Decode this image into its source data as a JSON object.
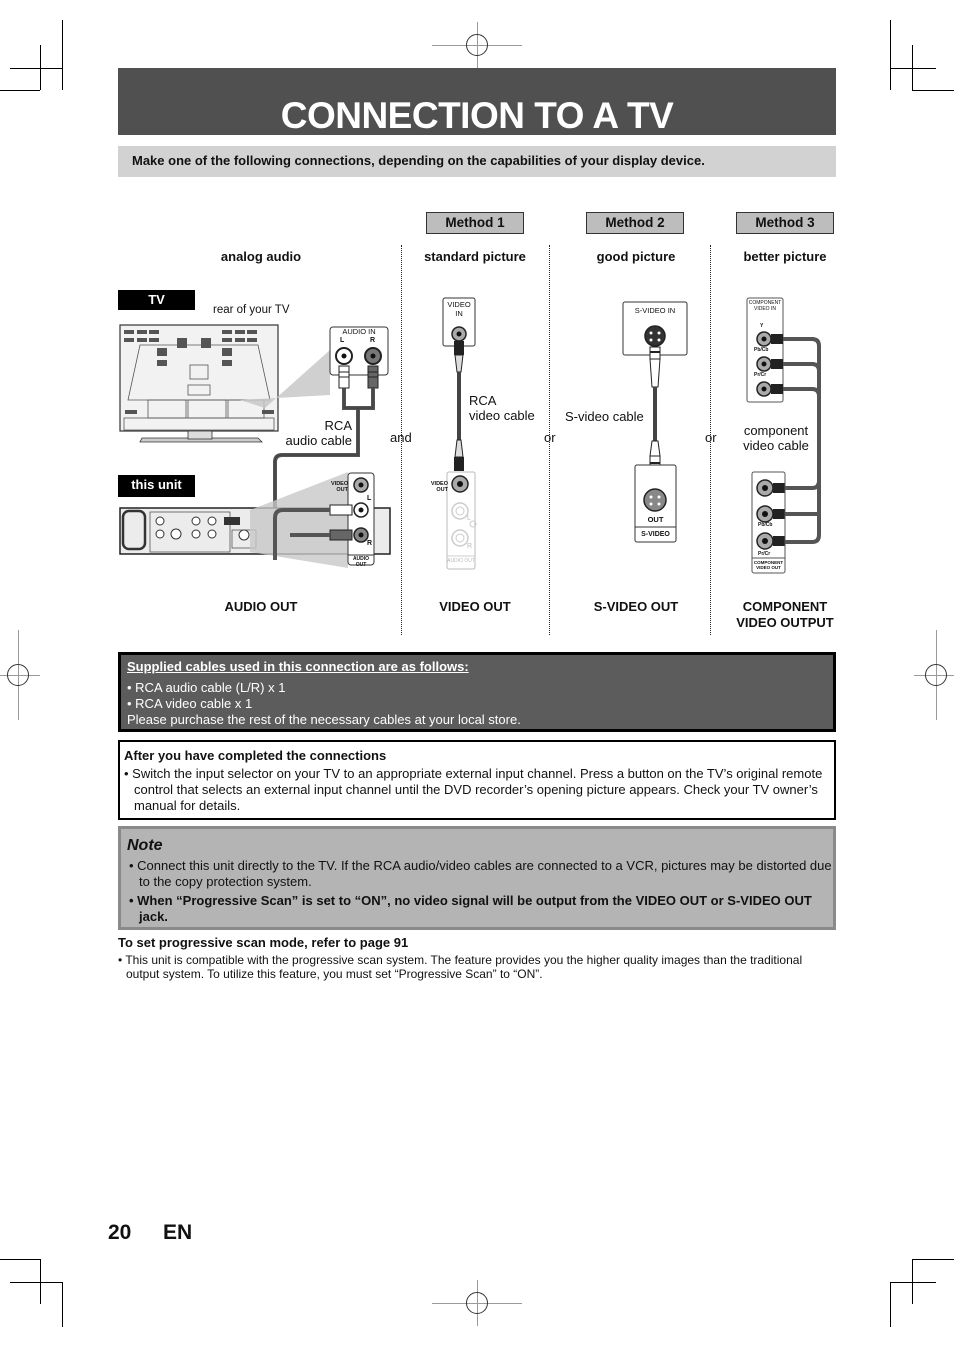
{
  "header": {
    "title": "CONNECTION TO A TV",
    "intro": "Make one of the following connections, depending on the capabilities of your display device."
  },
  "methods": [
    {
      "tab": "Method 1",
      "quality": "standard picture",
      "output": "VIDEO OUT",
      "cable": "RCA video cable",
      "cable_line1": "RCA",
      "cable_line2": "video cable"
    },
    {
      "tab": "Method 2",
      "quality": "good picture",
      "output": "S-VIDEO OUT",
      "cable": "S-video cable"
    },
    {
      "tab": "Method 3",
      "quality": "better picture",
      "output_line1": "COMPONENT",
      "output_line2": "VIDEO OUTPUT",
      "cable_line1": "component",
      "cable_line2": "video cable"
    }
  ],
  "audio": {
    "quality": "analog audio",
    "output": "AUDIO OUT",
    "cable_line1": "RCA",
    "cable_line2": "audio cable"
  },
  "diagram": {
    "tv_label": "TV",
    "tv_caption": "rear of your TV",
    "unit_label": "this unit",
    "audio_in": "AUDIO IN",
    "left": "L",
    "right": "R",
    "video_in_line1": "VIDEO",
    "video_in_line2": "IN",
    "video_out_line1": "VIDEO",
    "video_out_line2": "OUT",
    "audio_out": "AUDIO OUT",
    "svideo_in": "S-VIDEO IN",
    "svideo_out": "OUT",
    "svideo_label": "S-VIDEO",
    "component_in_line1": "COMPONENT",
    "component_in_line2": "VIDEO IN",
    "component_out_line1": "COMPONENT",
    "component_out_line2": "VIDEO OUT",
    "y": "Y",
    "pb": "Pb/Cb",
    "pr": "Pr/Cr",
    "and": "and",
    "or1": "or",
    "or2": "or"
  },
  "supplied": {
    "heading": "Supplied cables used in this connection are as follows:",
    "items": [
      "• RCA audio cable (L/R) x 1",
      "• RCA video cable x 1"
    ],
    "footer": "Please purchase the rest of the necessary cables at your local store."
  },
  "after": {
    "heading": "After you have completed the connections",
    "body": "• Switch the input selector on your TV to an appropriate external input channel. Press a button on the TV’s original remote control that selects an external input channel until the DVD recorder’s opening picture appears. Check your TV owner’s manual for details."
  },
  "note": {
    "heading": "Note",
    "items": [
      "• Connect this unit directly to the TV. If the RCA audio/video cables are connected to a VCR, pictures may be distorted due to the copy protection system.",
      "• When “Progressive Scan” is set to “ON”, no video signal will be output from the VIDEO OUT or S-VIDEO OUT jack."
    ]
  },
  "progressive": {
    "heading": "To set progressive scan mode, refer to page 91",
    "body": "• This unit is compatible with the progressive scan system. The feature provides you the higher quality images than the traditional output system. To utilize this feature, you must set “Progressive Scan” to “ON”."
  },
  "footer": {
    "page_number": "20",
    "language": "EN"
  }
}
